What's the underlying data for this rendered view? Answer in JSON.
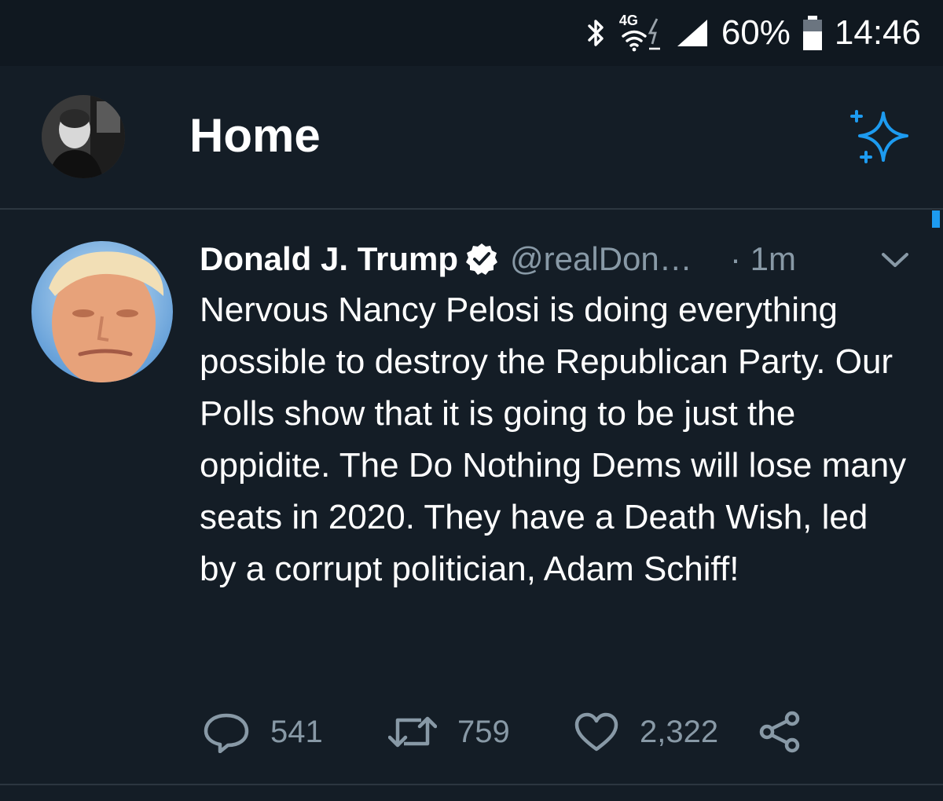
{
  "status_bar": {
    "network": "4G",
    "battery": "60%",
    "time": "14:46",
    "icons": [
      "bluetooth-icon",
      "wifi-icon",
      "signal-icon",
      "battery-icon"
    ]
  },
  "header": {
    "title": "Home",
    "icons": [
      "profile-avatar",
      "sparkle-icon"
    ]
  },
  "tweet": {
    "author_name": "Donald J. Trump",
    "handle": "@realDon…",
    "time": "· 1m",
    "text": "Nervous Nancy Pelosi is doing everything possible to destroy the Republican Party. Our Polls show that it is going to be just the oppidite. The Do Nothing Dems will lose many seats in 2020. They have a Death Wish, led by a corrupt politician, Adam Schiff!",
    "replies": "541",
    "retweets": "759",
    "likes": "2,322"
  },
  "colors": {
    "background": "#141d26",
    "accent": "#1d9bf0",
    "secondary_text": "#8899a6"
  }
}
